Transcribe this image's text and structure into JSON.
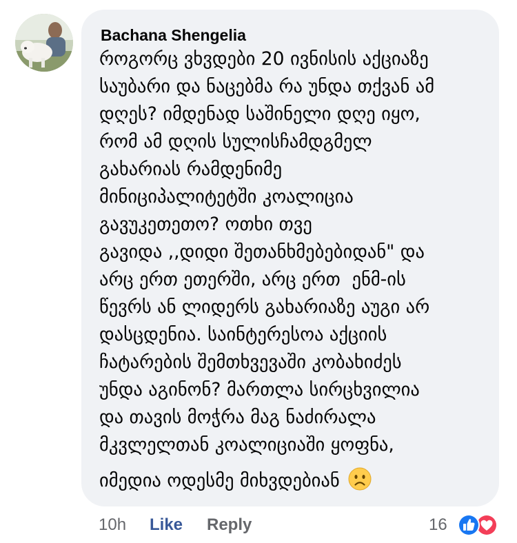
{
  "comment": {
    "author": "Bachana Shengelia",
    "lines": [
      "როგორც ვხვდები 20 ივნისის აქციაზე",
      "საუბარი და ნაცებმა რა უნდა თქვან ამ",
      "დღეს? იმდენად საშინელი დღე იყო,",
      "რომ ამ დღის სულისჩამდგმელ",
      "გახარიას რამდენიმე",
      "მინიციპალიტეტში კოალიცია",
      "გავუკეთეთო? ოთხი თვე",
      "გავიდა ,,დიდი შეთანხმებებიდან\" და",
      "არც ერთ ეთერში, არც ერთ  ენმ-ის",
      "წევრს ან ლიდერს გახარიაზე აუგი არ",
      "დასცდენია. საინტერესოა აქციის",
      "ჩატარების შემთხვევაში კობახიძეს",
      "უნდა აგინონ? მართლა სირცხვილია",
      "და თავის მოჭრა მაგ ნაძირალა",
      "მკვლელთან კოალიციაში ყოფნა,",
      "იმედია ოდესმე მიხვდებიან"
    ],
    "emoji": "frowning-face-emoji"
  },
  "actions": {
    "time": "10h",
    "like": "Like",
    "reply": "Reply",
    "reaction_count": "16",
    "reactions": [
      "like-reaction-icon",
      "love-reaction-icon"
    ]
  },
  "colors": {
    "bubble": "#f0f2f5",
    "text": "#050505",
    "meta": "#65676b",
    "like": "#385898",
    "like_reaction": "#1877f2",
    "love_reaction": "#f33e58"
  }
}
